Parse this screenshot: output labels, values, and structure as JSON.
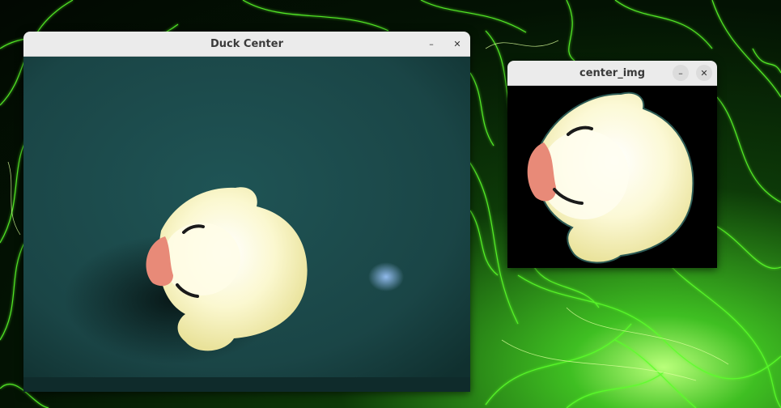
{
  "windows": {
    "main": {
      "title": "Duck Center",
      "minimize_label": "–",
      "close_label": "✕"
    },
    "crop": {
      "title": "center_img",
      "minimize_label": "–",
      "close_label": "✕"
    }
  },
  "colors": {
    "titlebar_bg": "#ebebeb",
    "title_text": "#3a3a3a",
    "camera_background": "#1c4a4c",
    "duck_body": "#f4f0b0",
    "duck_beak": "#e88a78",
    "wallpaper_glow": "#5cff2a"
  },
  "icons": [
    "minimize-icon",
    "close-icon"
  ]
}
